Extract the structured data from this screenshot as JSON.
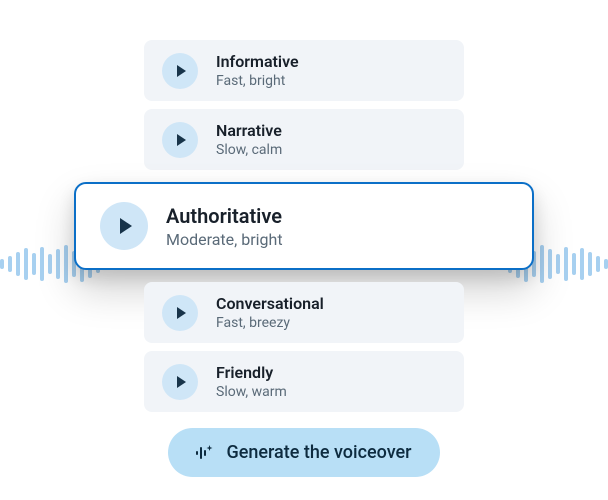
{
  "voices": [
    {
      "name": "Informative",
      "desc": "Fast, bright",
      "selected": false
    },
    {
      "name": "Narrative",
      "desc": "Slow, calm",
      "selected": false
    },
    {
      "name": "Authoritative",
      "desc": "Moderate, bright",
      "selected": true
    },
    {
      "name": "Conversational",
      "desc": "Fast, breezy",
      "selected": false
    },
    {
      "name": "Friendly",
      "desc": "Slow, warm",
      "selected": false
    }
  ],
  "generate_label": "Generate the voiceover",
  "colors": {
    "accent": "#0b6fc7",
    "card_bg": "#f1f4f8",
    "play_bg": "#cfe6f7",
    "wave": "#a7d0f0",
    "generate_bg": "#b8dff6"
  }
}
